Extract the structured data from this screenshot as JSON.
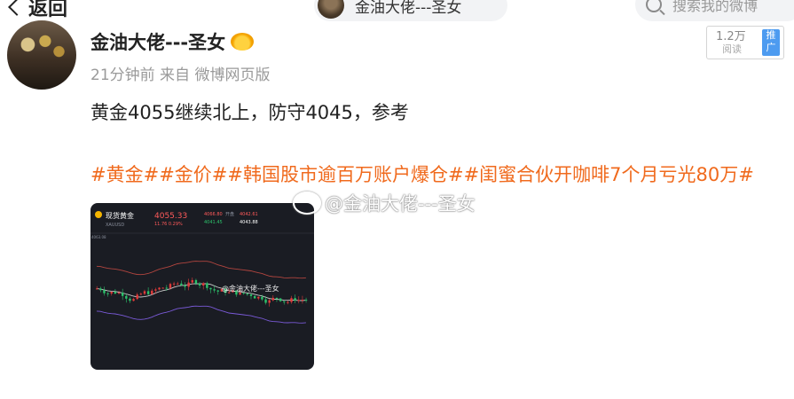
{
  "topbar": {
    "back_label": "返回",
    "account_pill": "金油大佬---圣女",
    "search_placeholder": "搜索我的微博"
  },
  "post": {
    "username": "金油大佬---圣女",
    "meta": "21分钟前 来自 微博网页版",
    "text": "黄金4055继续北上，防守4045，参考",
    "tags": "#黄金##金价##韩国股市逾百万账户爆仓##闺蜜合伙开咖啡7个月亏光80万#",
    "watermark": "@金油大佬---圣女",
    "ad": {
      "count": "1.2万",
      "sub": "阅读",
      "tag": "推广"
    }
  },
  "chart_image": {
    "header_title": "现货黄金",
    "header_code": "XAUUSD",
    "price": "4055.33",
    "change": "11.76  0.29%",
    "stats_open_label": "开盘",
    "stats_high": "4066.80",
    "stats_low": "4041.45",
    "stats_vol": "4042.61",
    "stats_last": "4043.88",
    "left_price": "4063.08",
    "image_watermark": "@金油大佬---圣女",
    "colors": {
      "up": "#e23b3b",
      "down": "#2cc26b",
      "upper_band": "#b2453f",
      "lower_band": "#7a5ad8",
      "bg": "#1a1c23"
    }
  }
}
